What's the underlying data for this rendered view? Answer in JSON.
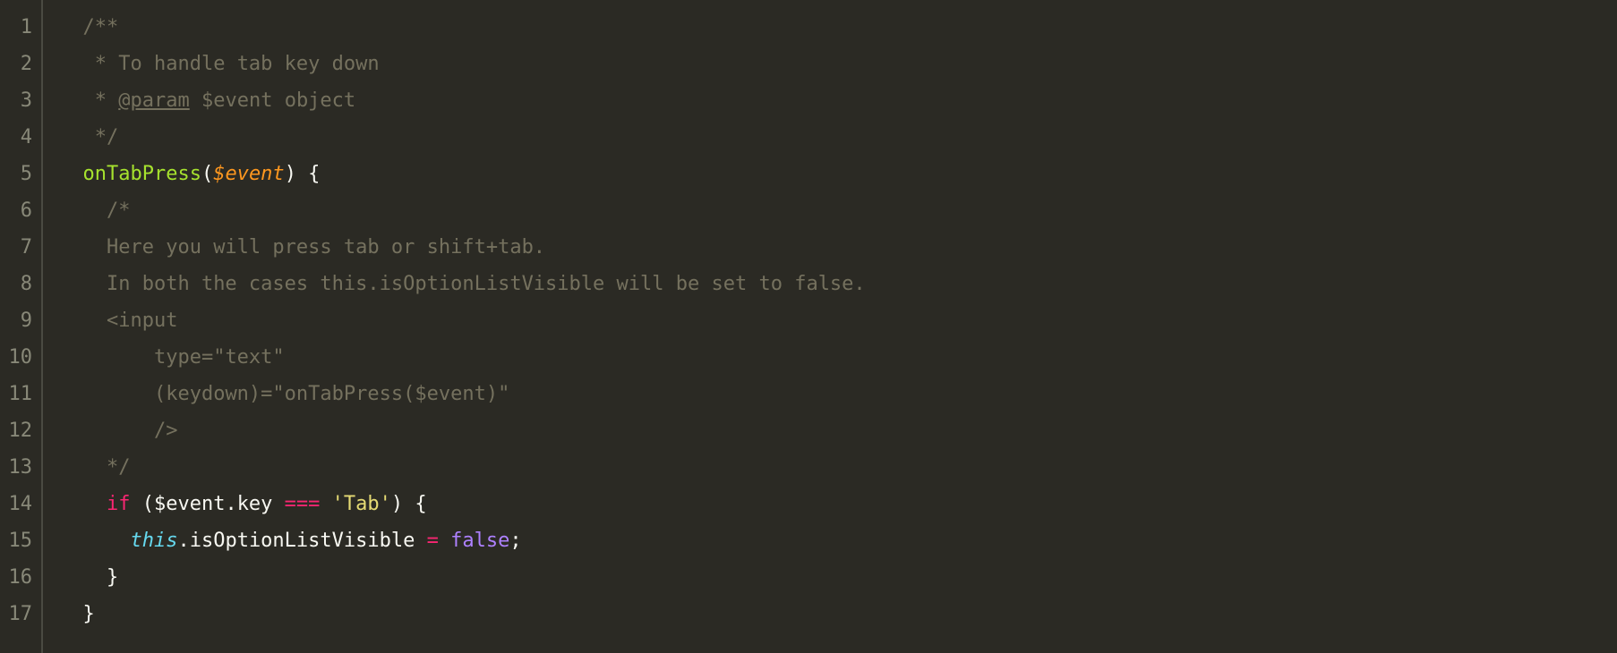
{
  "editor": {
    "lineCount": 17,
    "code": {
      "l1": {
        "indent": "  ",
        "seg1": "/**"
      },
      "l2": {
        "indent": "   ",
        "seg1": "* To handle tab key down"
      },
      "l3": {
        "indent": "   ",
        "seg1": "* ",
        "seg2": "@param",
        "seg3": " $event object"
      },
      "l4": {
        "indent": "   ",
        "seg1": "*/"
      },
      "l5": {
        "indent": "  ",
        "fn": "onTabPress",
        "seg2": "(",
        "param": "$event",
        "seg4": ") {"
      },
      "l6": {
        "indent": "    ",
        "seg1": "/*"
      },
      "l7": {
        "indent": "    ",
        "seg1": "Here you will press tab or shift+tab."
      },
      "l8": {
        "indent": "    ",
        "seg1": "In both the cases this.isOptionListVisible will be set to false."
      },
      "l9": {
        "indent": "    ",
        "seg1": "<input"
      },
      "l10": {
        "indent": "        ",
        "seg1": "type=\"text\""
      },
      "l11": {
        "indent": "        ",
        "seg1": "(keydown)=\"onTabPress($event)\""
      },
      "l12": {
        "indent": "        ",
        "seg1": "/>"
      },
      "l13": {
        "indent": "    ",
        "seg1": "*/"
      },
      "l14": {
        "indent": "    ",
        "kw": "if",
        "seg2": " ($event.key ",
        "op": "===",
        "seg4": " ",
        "str": "'Tab'",
        "seg6": ") {"
      },
      "l15": {
        "indent": "      ",
        "this": "this",
        "seg2": ".isOptionListVisible ",
        "op": "=",
        "seg4": " ",
        "const": "false",
        "seg6": ";"
      },
      "l16": {
        "indent": "    ",
        "seg1": "}"
      },
      "l17": {
        "indent": "  ",
        "seg1": "}"
      }
    }
  },
  "lineNumbers": [
    "1",
    "2",
    "3",
    "4",
    "5",
    "6",
    "7",
    "8",
    "9",
    "10",
    "11",
    "12",
    "13",
    "14",
    "15",
    "16",
    "17"
  ]
}
